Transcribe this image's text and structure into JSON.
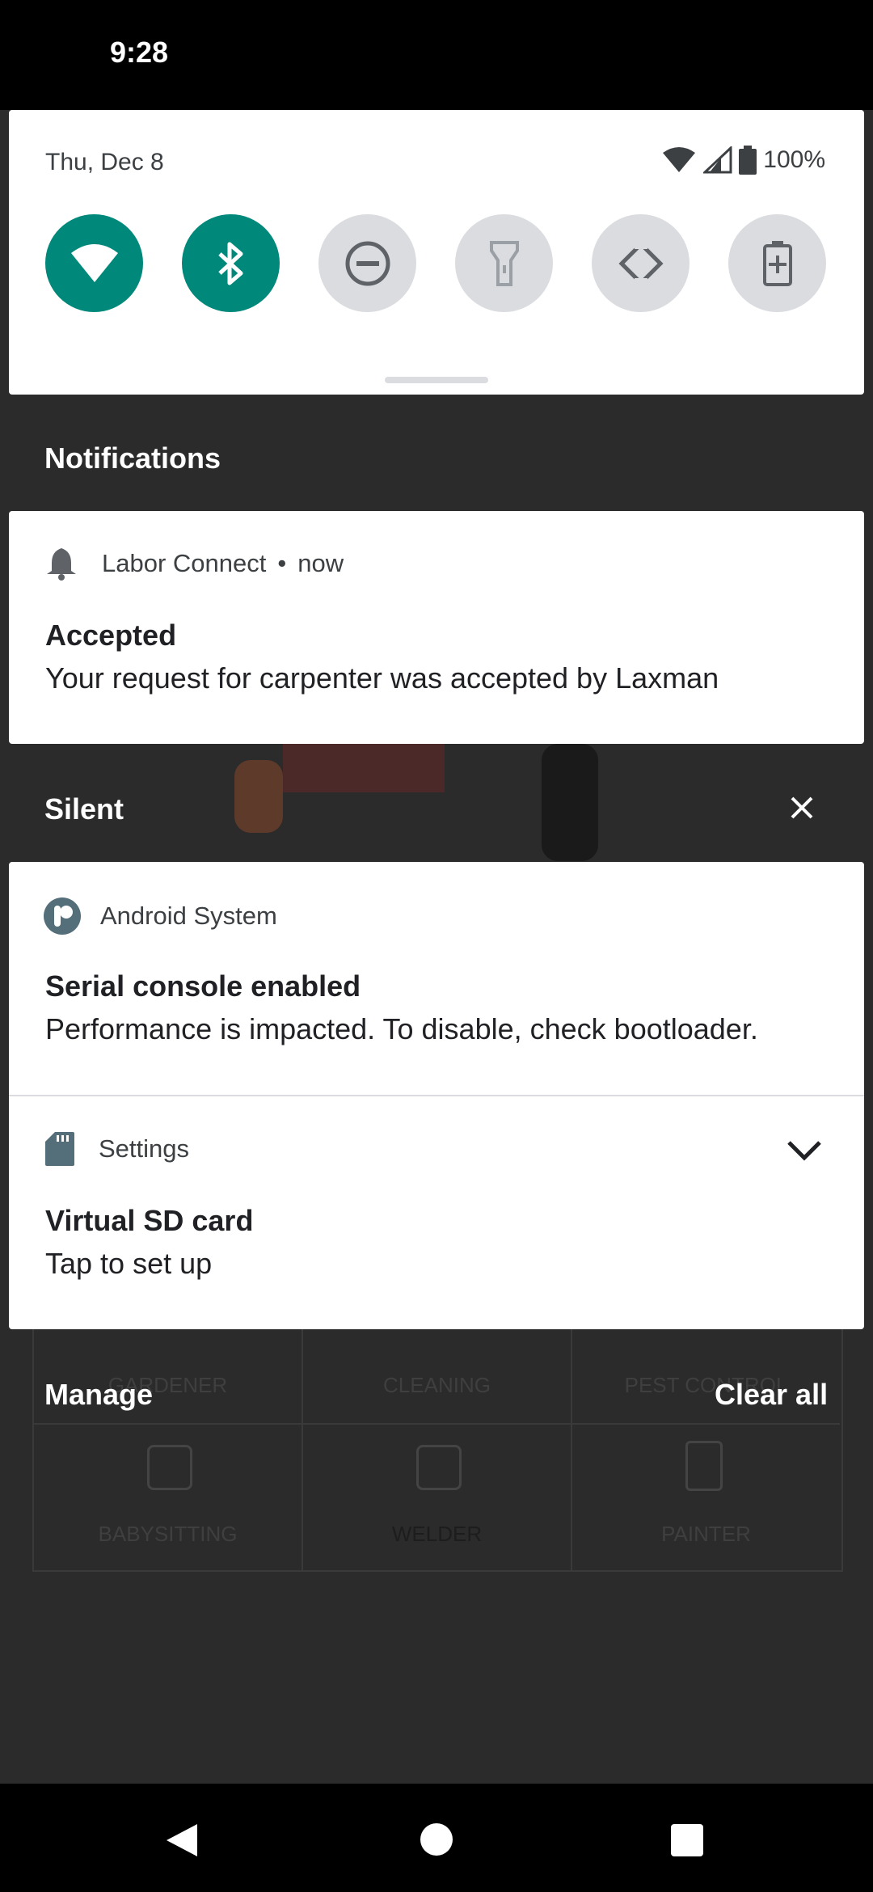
{
  "status_bar": {
    "time": "9:28"
  },
  "quick_settings": {
    "date": "Thu, Dec 8",
    "battery": "100%",
    "tiles": [
      {
        "name": "wifi-icon",
        "on": true
      },
      {
        "name": "bluetooth-icon",
        "on": true
      },
      {
        "name": "do-not-disturb-icon",
        "on": false
      },
      {
        "name": "flashlight-icon",
        "on": false
      },
      {
        "name": "auto-rotate-icon",
        "on": false
      },
      {
        "name": "battery-saver-icon",
        "on": false
      }
    ],
    "accent": "#00897b"
  },
  "notifications": {
    "header": "Notifications",
    "items": [
      {
        "app": "Labor Connect",
        "time": "now",
        "title": "Accepted",
        "body": "Your request for carpenter was accepted by Laxman"
      }
    ]
  },
  "silent": {
    "header": "Silent",
    "items": [
      {
        "app": "Android System",
        "title": "Serial console enabled",
        "body": "Performance is impacted. To disable, check bootloader."
      },
      {
        "app": "Settings",
        "title": "Virtual SD card",
        "body": "Tap to set up"
      }
    ]
  },
  "footer": {
    "manage": "Manage",
    "clear_all": "Clear all"
  },
  "background_app": {
    "categories_row1": [
      "GARDENER",
      "CLEANING",
      "PEST CONTROL"
    ],
    "categories_row2": [
      "BABYSITTING",
      "WELDER",
      "PAINTER"
    ]
  }
}
